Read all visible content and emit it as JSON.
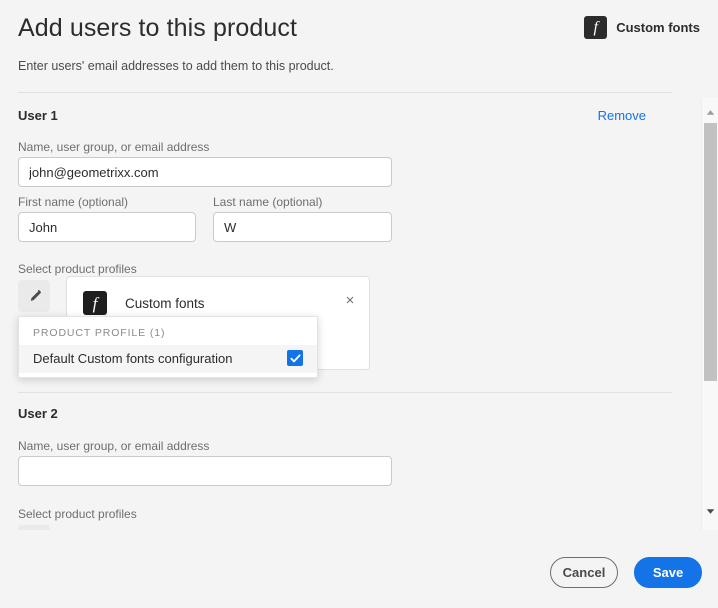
{
  "header": {
    "title": "Add users to this product",
    "subtitle": "Enter users' email addresses to add them to this product.",
    "product_chip": {
      "icon": "custom-fonts-f-icon",
      "glyph": "f",
      "label": "Custom fonts"
    }
  },
  "users": [
    {
      "section_title": "User 1",
      "remove_label": "Remove",
      "identity_label": "Name, user group, or email address",
      "identity_value": "john@geometrixx.com",
      "identity_placeholder": "",
      "first_name_label": "First name (optional)",
      "first_name_value": "John",
      "last_name_label": "Last name (optional)",
      "last_name_value": "W",
      "profiles_label": "Select product profiles",
      "edit_icon": "pencil-icon",
      "profile_card": {
        "icon": "custom-fonts-f-icon",
        "glyph": "f",
        "label": "Custom fonts",
        "close_icon": "close-icon",
        "close_glyph": "×"
      },
      "dropdown": {
        "header": "PRODUCT PROFILE (1)",
        "option_label": "Default Custom fonts configuration",
        "option_checked": true,
        "check_glyph": "✔"
      }
    },
    {
      "section_title": "User 2",
      "identity_label": "Name, user group, or email address",
      "identity_value": "",
      "identity_placeholder": "",
      "profiles_label": "Select product profiles"
    }
  ],
  "scrollbar": {
    "up_arrow_icon": "chevron-up-icon",
    "up_glyph": "▲",
    "down_arrow_icon": "chevron-down-icon",
    "down_glyph": "▼"
  },
  "footer": {
    "cancel_label": "Cancel",
    "save_label": "Save"
  },
  "colors": {
    "accent_blue": "#1473e6",
    "page_background": "#f4f4f4",
    "text_primary": "#2c2c2c",
    "text_secondary": "#6e6e6e"
  }
}
